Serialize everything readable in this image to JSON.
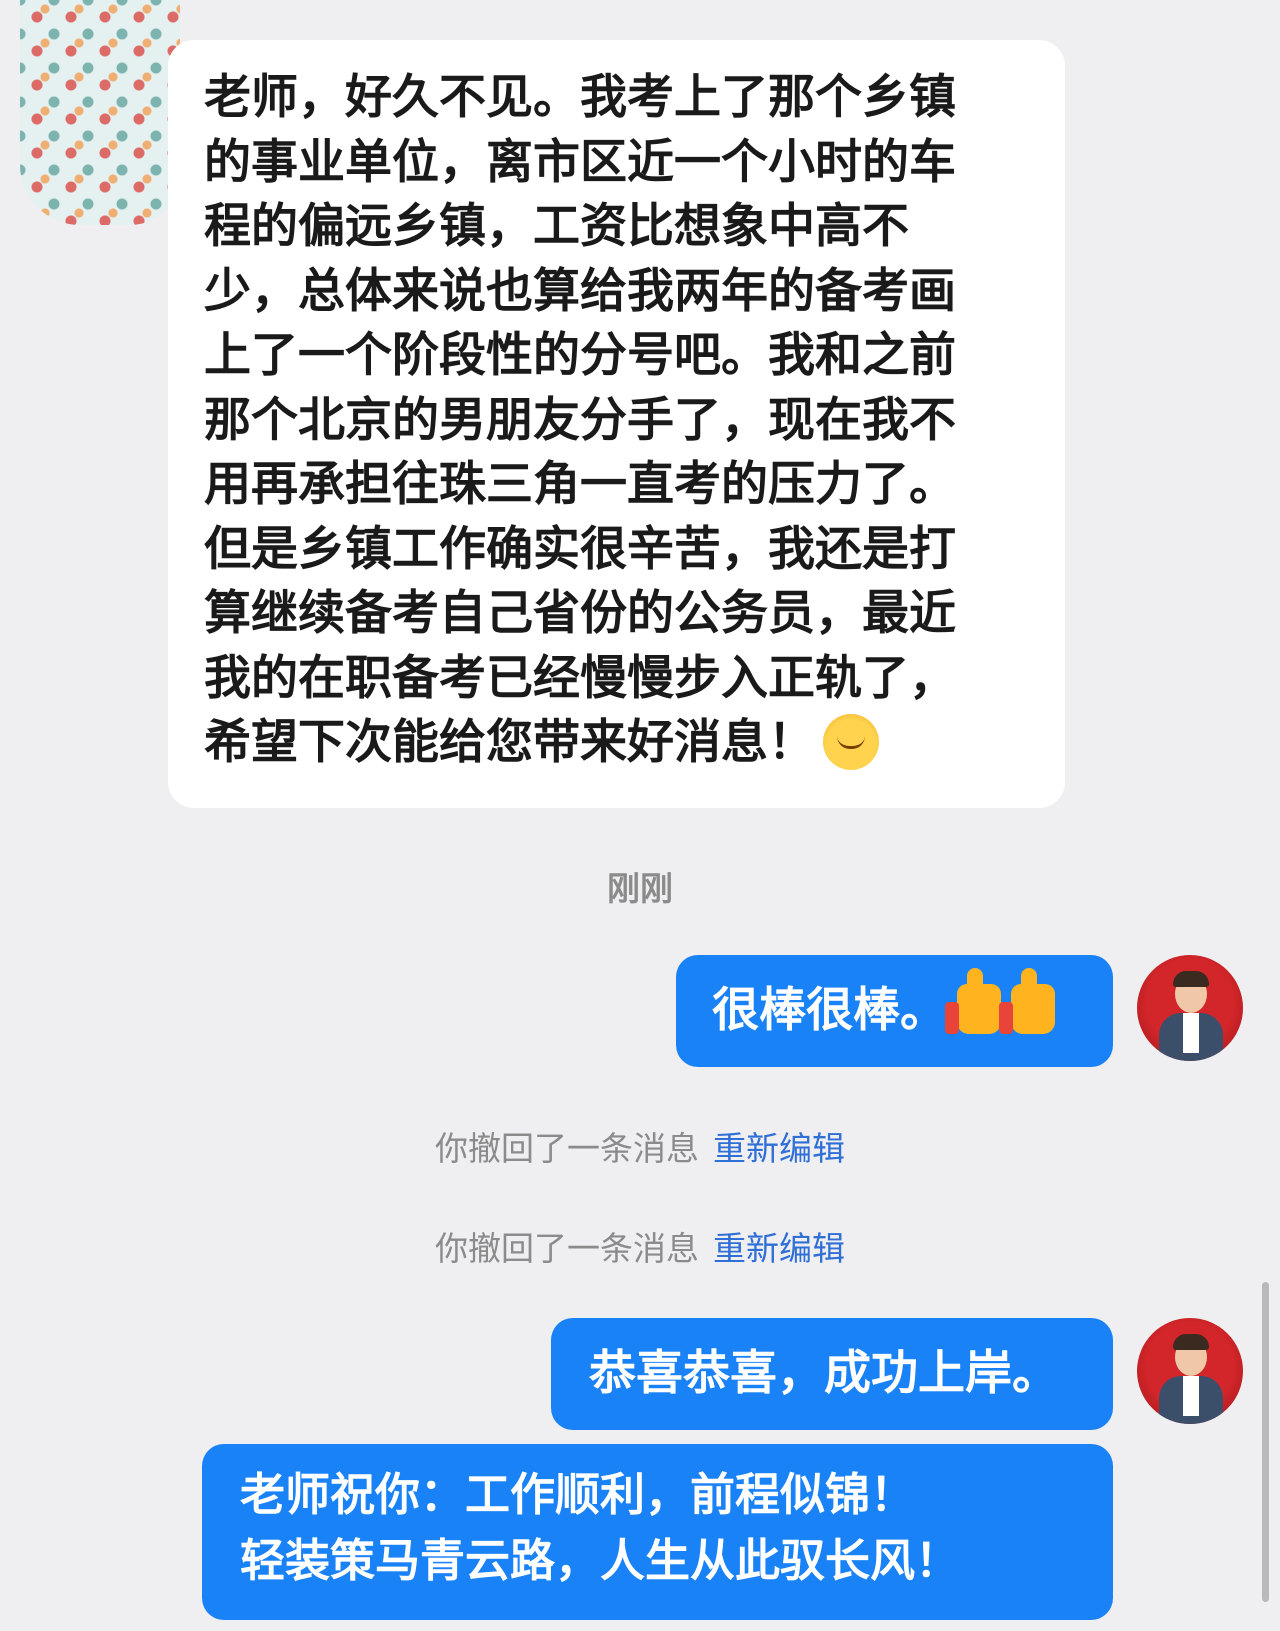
{
  "incoming_message": {
    "lines": [
      "老师，好久不见。我考上了那个乡镇",
      "的事业单位，离市区近一个小时的车",
      "程的偏远乡镇，工资比想象中高不",
      "少，总体来说也算给我两年的备考画",
      "上了一个阶段性的分号吧。我和之前",
      "那个北京的男朋友分手了，现在我不",
      "用再承担往珠三角一直考的压力了。",
      "但是乡镇工作确实很辛苦，我还是打",
      "算继续备考自己省份的公务员，最近",
      "我的在职备考已经慢慢步入正轨了，",
      "希望下次能给您带来好消息！"
    ],
    "emoji": "smiling-chick-emoji"
  },
  "timestamp": "刚刚",
  "outgoing_messages": [
    {
      "text": "很棒很棒。",
      "emoji": "thumbs-up-emoji"
    },
    {
      "text": "恭喜恭喜，成功上岸。"
    },
    {
      "lines": [
        "老师祝你：工作顺利，前程似锦！",
        "轻装策马青云路，人生从此驭长风！"
      ]
    }
  ],
  "recall_notices": [
    {
      "text": "你撤回了一条消息",
      "action": "重新编辑"
    },
    {
      "text": "你撤回了一条消息",
      "action": "重新编辑"
    }
  ],
  "colors": {
    "background": "#efeff1",
    "outgoing_bubble": "#1a82f7",
    "incoming_bubble": "#ffffff",
    "link": "#2f6fd6",
    "muted_text": "#8b8b8b"
  }
}
